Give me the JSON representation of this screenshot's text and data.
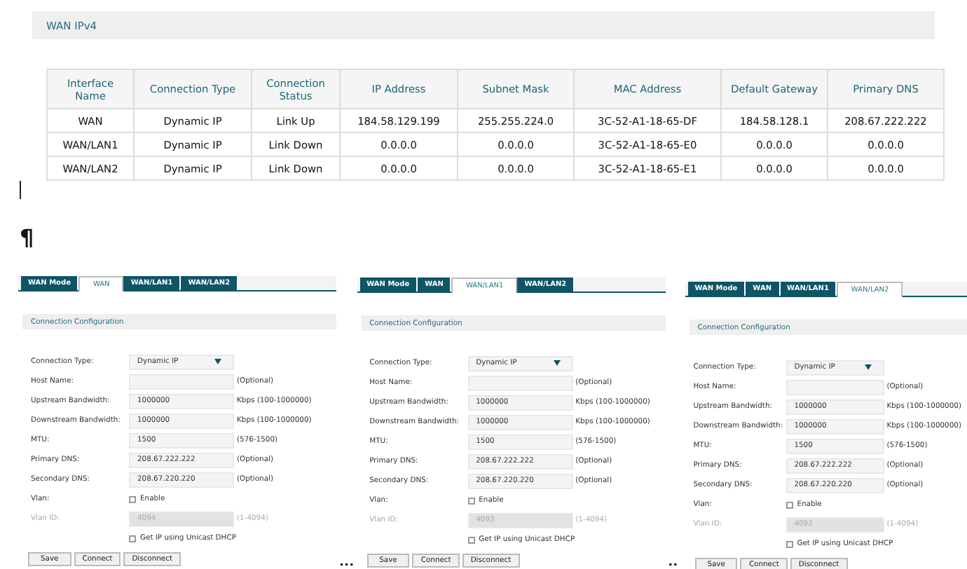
{
  "header": {
    "title": "WAN IPv4"
  },
  "table": {
    "columns": [
      "Interface Name",
      "Connection Type",
      "Connection Status",
      "IP Address",
      "Subnet Mask",
      "MAC Address",
      "Default Gateway",
      "Primary DNS"
    ],
    "rows": [
      [
        "WAN",
        "Dynamic IP",
        "Link Up",
        "184.58.129.199",
        "255.255.224.0",
        "3C-52-A1-18-65-DF",
        "184.58.128.1",
        "208.67.222.222"
      ],
      [
        "WAN/LAN1",
        "Dynamic IP",
        "Link Down",
        "0.0.0.0",
        "0.0.0.0",
        "3C-52-A1-18-65-E0",
        "0.0.0.0",
        "0.0.0.0"
      ],
      [
        "WAN/LAN2",
        "Dynamic IP",
        "Link Down",
        "0.0.0.0",
        "0.0.0.0",
        "3C-52-A1-18-65-E1",
        "0.0.0.0",
        "0.0.0.0"
      ]
    ]
  },
  "pilcrow": "¶",
  "panels": [
    {
      "tabs": [
        {
          "label": "WAN Mode",
          "selected": false
        },
        {
          "label": "WAN",
          "selected": true
        },
        {
          "label": "WAN/LAN1",
          "selected": false
        },
        {
          "label": "WAN/LAN2",
          "selected": false
        }
      ],
      "section_title": "Connection Configuration",
      "fields": [
        {
          "kind": "select",
          "label": "Connection Type:",
          "value": "Dynamic IP",
          "disabled": false
        },
        {
          "kind": "input",
          "label": "Host Name:",
          "hint": "(Optional)",
          "disabled": false
        },
        {
          "kind": "input",
          "label": "Upstream Bandwidth:",
          "value": "1000000",
          "hint": "Kbps (100-1000000)",
          "disabled": false
        },
        {
          "kind": "input",
          "label": "Downstream Bandwidth:",
          "value": "1000000",
          "hint": "Kbps (100-1000000)",
          "disabled": false
        },
        {
          "kind": "input",
          "label": "MTU:",
          "value": "1500",
          "hint": "(576-1500)",
          "disabled": false
        },
        {
          "kind": "input",
          "label": "Primary DNS:",
          "value": "208.67.222.222",
          "hint": "(Optional)",
          "disabled": false
        },
        {
          "kind": "input",
          "label": "Secondary DNS:",
          "value": "208.67.220.220",
          "hint": "(Optional)",
          "disabled": false
        },
        {
          "kind": "checkbox",
          "label": "Vlan:",
          "text": "Enable",
          "checked": false,
          "disabled": false
        },
        {
          "kind": "input",
          "label": "Vlan ID:",
          "value": "4094",
          "hint": "(1-4094)",
          "disabled": true
        },
        {
          "kind": "checkbox",
          "text": "Get IP using Unicast DHCP",
          "checked": false,
          "disabled": false
        }
      ],
      "buttons": [
        "Save",
        "Connect",
        "Disconnect"
      ]
    },
    {
      "tabs": [
        {
          "label": "WAN Mode",
          "selected": false
        },
        {
          "label": "WAN",
          "selected": false
        },
        {
          "label": "WAN/LAN1",
          "selected": true
        },
        {
          "label": "WAN/LAN2",
          "selected": false
        }
      ],
      "section_title": "Connection Configuration",
      "fields": [
        {
          "kind": "select",
          "label": "Connection Type:",
          "value": "Dynamic IP",
          "disabled": false
        },
        {
          "kind": "input",
          "label": "Host Name:",
          "hint": "(Optional)",
          "disabled": false
        },
        {
          "kind": "input",
          "label": "Upstream Bandwidth:",
          "value": "1000000",
          "hint": "Kbps (100-1000000)",
          "disabled": false
        },
        {
          "kind": "input",
          "label": "Downstream Bandwidth:",
          "value": "1000000",
          "hint": "Kbps (100-1000000)",
          "disabled": false
        },
        {
          "kind": "input",
          "label": "MTU:",
          "value": "1500",
          "hint": "(576-1500)",
          "disabled": false
        },
        {
          "kind": "input",
          "label": "Primary DNS:",
          "value": "208.67.222.222",
          "hint": "(Optional)",
          "disabled": false
        },
        {
          "kind": "input",
          "label": "Secondary DNS:",
          "value": "208.67.220.220",
          "hint": "(Optional)",
          "disabled": false
        },
        {
          "kind": "checkbox",
          "label": "Vlan:",
          "text": "Enable",
          "checked": false,
          "disabled": false
        },
        {
          "kind": "input",
          "label": "Vlan ID:",
          "value": "4093",
          "hint": "(1-4094)",
          "disabled": true
        },
        {
          "kind": "checkbox",
          "text": "Get IP using Unicast DHCP",
          "checked": false,
          "disabled": false
        }
      ],
      "buttons": [
        "Save",
        "Connect",
        "Disconnect"
      ]
    },
    {
      "tabs": [
        {
          "label": "WAN Mode",
          "selected": false
        },
        {
          "label": "WAN",
          "selected": false
        },
        {
          "label": "WAN/LAN1",
          "selected": false
        },
        {
          "label": "WAN/LAN2",
          "selected": true
        }
      ],
      "section_title": "Connection Configuration",
      "fields": [
        {
          "kind": "select",
          "label": "Connection Type:",
          "value": "Dynamic IP",
          "disabled": false
        },
        {
          "kind": "input",
          "label": "Host Name:",
          "hint": "(Optional)",
          "disabled": false
        },
        {
          "kind": "input",
          "label": "Upstream Bandwidth:",
          "value": "1000000",
          "hint": "Kbps (100-1000000)",
          "disabled": false
        },
        {
          "kind": "input",
          "label": "Downstream Bandwidth:",
          "value": "1000000",
          "hint": "Kbps (100-1000000)",
          "disabled": false
        },
        {
          "kind": "input",
          "label": "MTU:",
          "value": "1500",
          "hint": "(576-1500)",
          "disabled": false
        },
        {
          "kind": "input",
          "label": "Primary DNS:",
          "value": "208.67.222.222",
          "hint": "(Optional)",
          "disabled": false
        },
        {
          "kind": "input",
          "label": "Secondary DNS:",
          "value": "208.67.220.220",
          "hint": "(Optional)",
          "disabled": false
        },
        {
          "kind": "checkbox",
          "label": "Vlan:",
          "text": "Enable",
          "checked": false,
          "disabled": false
        },
        {
          "kind": "input",
          "label": "Vlan ID:",
          "value": "4092",
          "hint": "(1-4094)",
          "disabled": true
        },
        {
          "kind": "checkbox",
          "text": "Get IP using Unicast DHCP",
          "checked": false,
          "disabled": false
        }
      ],
      "buttons": [
        "Save",
        "Connect",
        "Disconnect"
      ]
    }
  ],
  "gap_marks": [
    "•••",
    "••"
  ]
}
